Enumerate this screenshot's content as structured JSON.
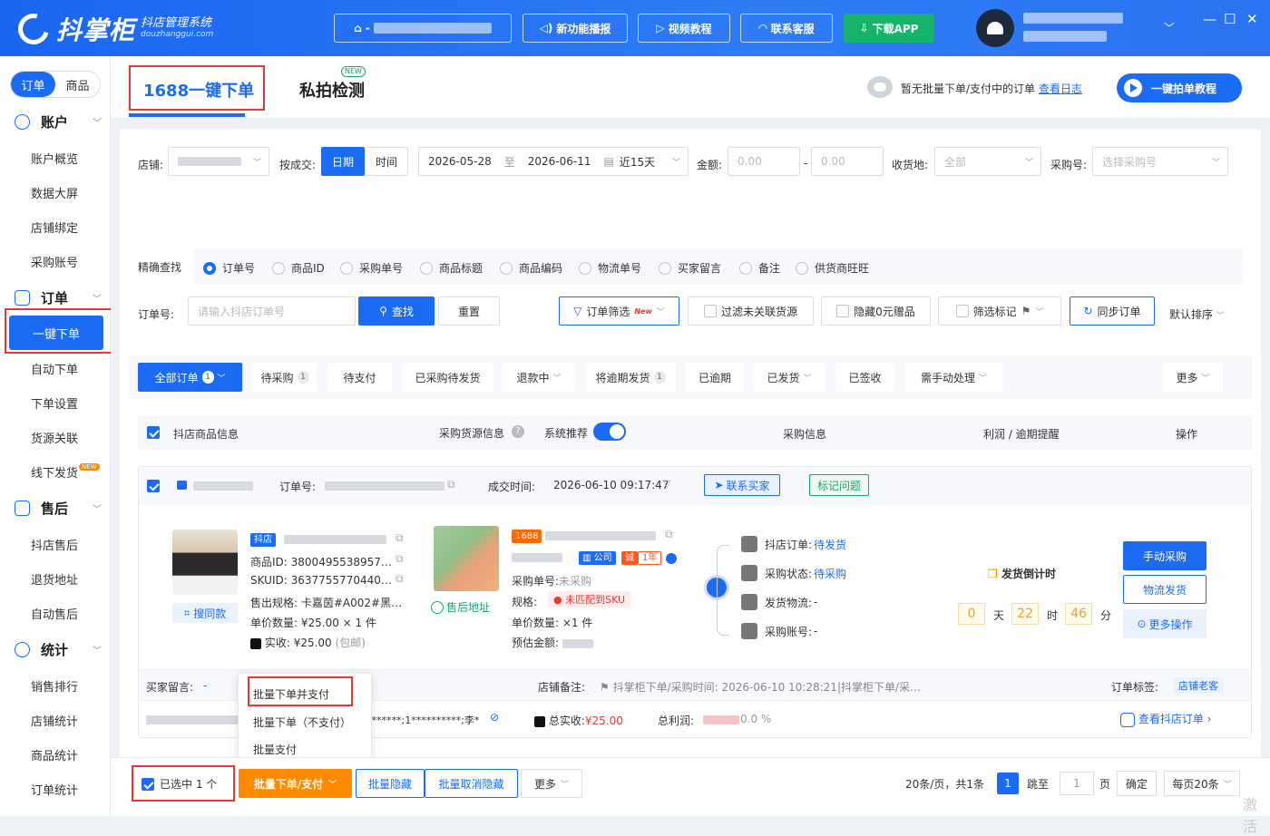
{
  "app": {
    "name": "抖掌柜",
    "subtitle": "抖店管理系统",
    "domain": "douzhanggui.com"
  },
  "topbar": {
    "shop_selector_prefix": "-",
    "buttons": [
      {
        "label": "新功能播报",
        "icon": "megaphone-icon"
      },
      {
        "label": "视频教程",
        "icon": "video-icon"
      },
      {
        "label": "联系客服",
        "icon": "headset-icon"
      },
      {
        "label": "下载APP",
        "icon": "download-icon"
      }
    ],
    "window_controls": [
      "—",
      "☐",
      "✕"
    ]
  },
  "sidebar": {
    "toggle": {
      "orders": "订单",
      "products": "商品"
    },
    "sections": [
      {
        "title": "账户",
        "items": [
          "账户概览",
          "数据大屏",
          "店铺绑定",
          "采购账号"
        ]
      },
      {
        "title": "订单",
        "items": [
          "一键下单",
          "自动下单",
          "下单设置",
          "货源关联",
          "线下发货"
        ]
      },
      {
        "title": "售后",
        "items": [
          "抖店售后",
          "退货地址",
          "自动售后"
        ]
      },
      {
        "title": "统计",
        "items": [
          "销售排行",
          "店铺统计",
          "商品统计",
          "订单统计"
        ]
      }
    ],
    "new_tag": "NEW"
  },
  "tabs": {
    "tab1": "1688一键下单",
    "tab2": "私拍检测",
    "tab2_badge": "NEW"
  },
  "header": {
    "empty_msg": "暂无批量下单/支付中的订单",
    "log_link": "查看日志",
    "tutorial_btn": "一键拍单教程"
  },
  "filters": {
    "shop_label": "店铺:",
    "deal_label": "按成交:",
    "deal_options": [
      "日期",
      "时间"
    ],
    "date_from": "2026-05-28",
    "date_sep": "至",
    "date_to": "2026-06-11",
    "date_range": "近15天",
    "amount_label": "金额:",
    "amount_min": "0.00",
    "amount_sep": "-",
    "amount_max": "0.00",
    "receive_label": "收货地:",
    "receive_value": "全部",
    "purchase_label": "采购号:",
    "purchase_placeholder": "选择采购号",
    "precise_label": "精确查找",
    "radios": [
      "订单号",
      "商品ID",
      "采购单号",
      "商品标题",
      "商品编码",
      "物流单号",
      "买家留言",
      "备注",
      "供货商旺旺"
    ],
    "order_label": "订单号:",
    "order_placeholder": "请输入抖店订单号",
    "search_btn": "查找",
    "reset_btn": "重置",
    "order_filter_btn": "订单筛选",
    "order_filter_new": "New",
    "filter_unlinked": "过滤未关联货源",
    "hide_zero": "隐藏0元赠品",
    "filter_mark": "筛选标记",
    "sync_btn": "同步订单",
    "sort": "默认排序"
  },
  "status_tabs": [
    {
      "label": "全部订单",
      "count": "1"
    },
    {
      "label": "待采购",
      "count": "1"
    },
    {
      "label": "待支付"
    },
    {
      "label": "已采购待发货"
    },
    {
      "label": "退款中"
    },
    {
      "label": "将逾期发货",
      "count": "1"
    },
    {
      "label": "已逾期"
    },
    {
      "label": "已发货"
    },
    {
      "label": "已签收"
    },
    {
      "label": "需手动处理"
    },
    {
      "label": "更多"
    }
  ],
  "table_head": {
    "col1": "抖店商品信息",
    "col2": "采购货源信息",
    "col3": "系统推荐",
    "col4": "采购信息",
    "col5": "利润 / 逾期提醒",
    "col6": "操作"
  },
  "order": {
    "order_no_label": "订单号:",
    "deal_time_label": "成交时间:",
    "deal_time": "2026-06-10 09:17:47",
    "contact_btn": "联系买家",
    "mark_btn": "标记问题",
    "shop_badge": "抖店",
    "product_id_label": "商品ID:",
    "product_id": "3800495538957…",
    "skuid_label": "SKUID:",
    "skuid": "3637755770440…",
    "spec_label": "售出规格:",
    "spec": "卡嘉茵#A002#黑…",
    "price_qty_label": "单价数量:",
    "price_qty": "¥25.00 × 1 件",
    "paid_label": "实收:",
    "paid": "¥25.00",
    "paid_note": "(包邮)",
    "same_style": "搜同款",
    "after_sale_addr": "售后地址",
    "badge_1688": "1688",
    "company_badge": "公司",
    "cheng_badge": "诚",
    "year_badge": "1年",
    "purchase_no_label": "采购单号:",
    "purchase_no": "未采购",
    "spec2_label": "规格:",
    "sku_warning": "未匹配到SKU",
    "price_qty2_label": "单价数量:",
    "price_qty2": "×1 件",
    "est_amount_label": "预估金额:",
    "status_list": [
      {
        "label": "抖店订单:",
        "value": "待发货"
      },
      {
        "label": "采购状态:",
        "value": "待采购"
      },
      {
        "label": "发货物流:",
        "value": "-"
      },
      {
        "label": "采购账号:",
        "value": "-"
      }
    ],
    "countdown_title": "发货倒计时",
    "countdown": {
      "days": "0",
      "days_unit": "天",
      "hours": "22",
      "hours_unit": "时",
      "minutes": "46",
      "minutes_unit": "分"
    },
    "btn_manual": "手动采购",
    "btn_logistics": "物流发货",
    "btn_more": "更多操作",
    "buyer_msg_label": "买家留言:",
    "buyer_msg": "-",
    "shop_note_label": "店铺备注:",
    "shop_note": "抖掌柜下单/采购时间: 2026-06-10 10:28:21|抖掌柜下单/采…",
    "order_tag_label": "订单标签:",
    "order_tag": "店铺老客",
    "address_tail": "*********;1**********;李*",
    "total_paid_label": "总实收:",
    "total_paid": "¥25.00",
    "profit_label": "总利润:",
    "profit": "0.0 %",
    "view_order": "查看抖店订单"
  },
  "dropdown": {
    "items": [
      "批量下单并支付",
      "批量下单（不支付）",
      "批量支付"
    ]
  },
  "bottom": {
    "selected": "已选中 1 个",
    "batch_btn": "批量下单/支付",
    "batch_hide": "批量隐藏",
    "batch_unhide": "批量取消隐藏",
    "more": "更多",
    "page_info": "20条/页，共1条",
    "current_page": "1",
    "jump_label": "跳至",
    "jump_value": "1",
    "page_unit": "页",
    "confirm": "确定",
    "page_size": "每页20条",
    "watermark": "激活"
  }
}
